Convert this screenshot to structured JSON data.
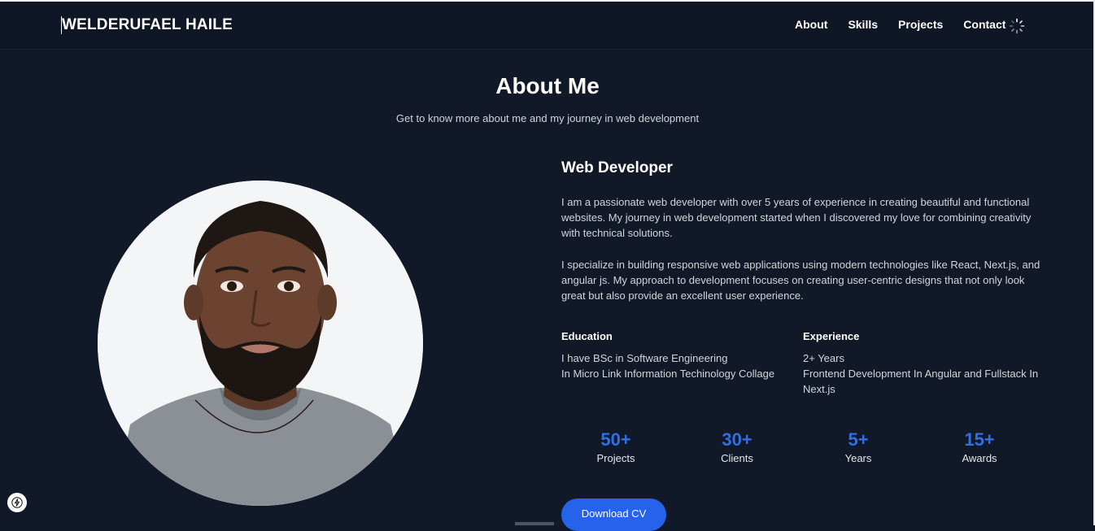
{
  "header": {
    "brand": "WELDERUFAEL HAILE",
    "nav": [
      "About",
      "Skills",
      "Projects",
      "Contact"
    ]
  },
  "about": {
    "title": "About Me",
    "subtitle": "Get to know more about me and my journey in web development",
    "role": "Web Developer",
    "paragraphs": [
      "I am a passionate web developer with over 5 years of experience in creating beautiful and functional websites. My journey in web development started when I discovered my love for combining creativity with technical solutions.",
      "I specialize in building responsive web applications using modern technologies like React, Next.js, and angular js. My approach to development focuses on creating user-centric designs that not only look great but also provide an excellent user experience."
    ],
    "education": {
      "heading": "Education",
      "lines": [
        "I have BSc in Software Engineering",
        "In Micro Link Information Techinology Collage"
      ]
    },
    "experience": {
      "heading": "Experience",
      "lines": [
        "2+ Years",
        "Frontend Development In Angular and Fullstack In Next.js"
      ]
    },
    "stats": [
      {
        "value": "50+",
        "label": "Projects"
      },
      {
        "value": "30+",
        "label": "Clients"
      },
      {
        "value": "5+",
        "label": "Years"
      },
      {
        "value": "15+",
        "label": "Awards"
      }
    ],
    "cv_button": "Download CV"
  },
  "icons": {
    "theme_toggle": "loading-spinner-icon",
    "corner_button": "lightning-icon"
  },
  "colors": {
    "background": "#111827",
    "accent": "#2f6fe8",
    "button": "#2563eb"
  }
}
